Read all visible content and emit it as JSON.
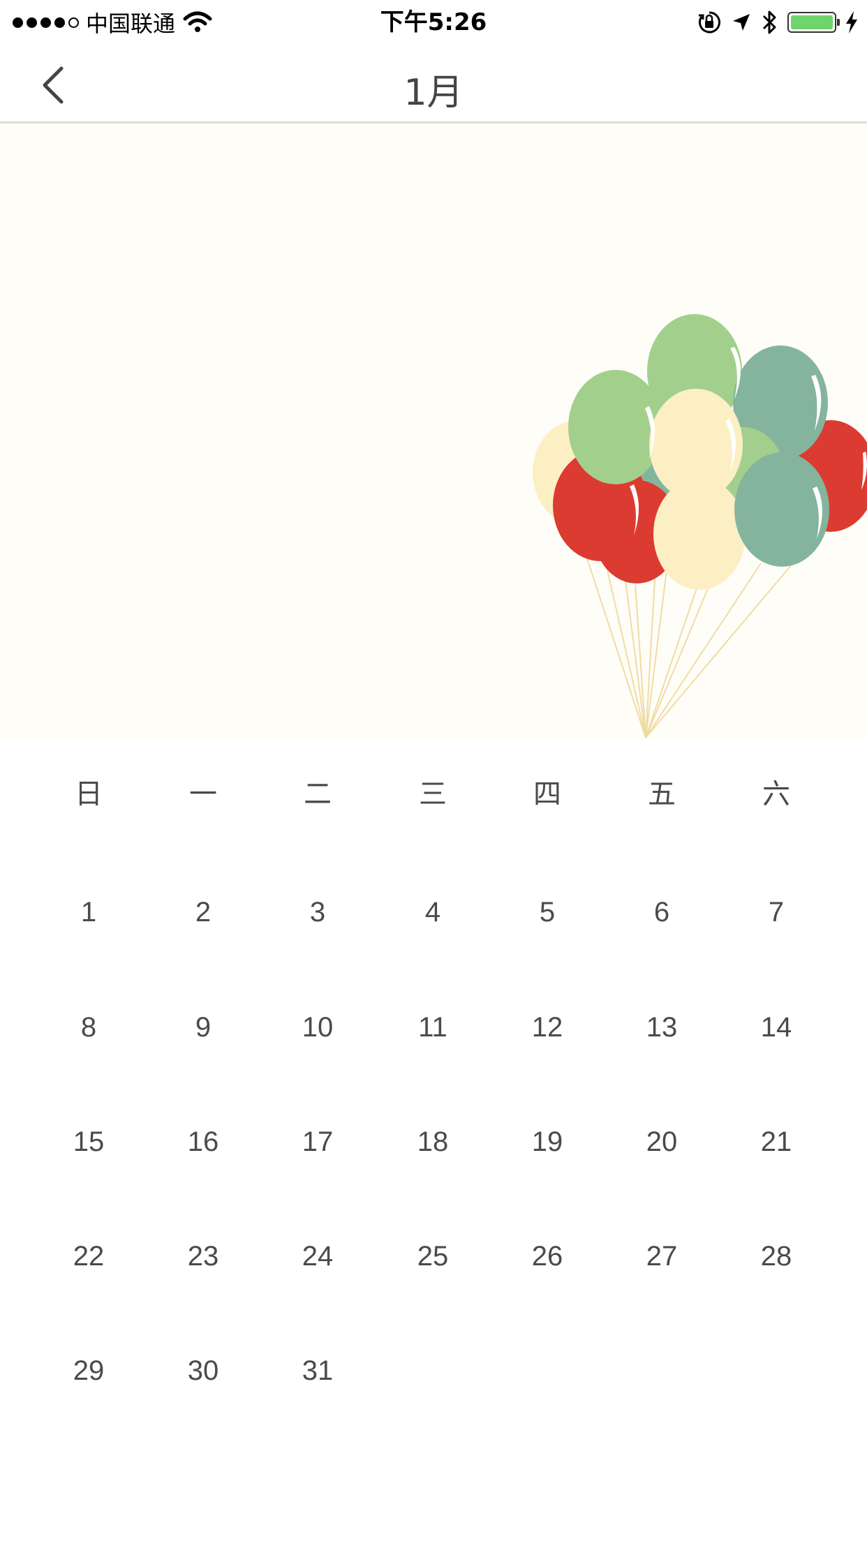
{
  "status_bar": {
    "carrier": "中国联通",
    "time": "下午5:26",
    "battery_color": "#6fd46c"
  },
  "nav": {
    "title": "1月",
    "back_icon": "chevron-left-icon"
  },
  "banner": {
    "illustration": "balloons",
    "background": "#fffdf7"
  },
  "calendar": {
    "weekdays": [
      "日",
      "一",
      "二",
      "三",
      "四",
      "五",
      "六"
    ],
    "weeks": [
      [
        "1",
        "2",
        "3",
        "4",
        "5",
        "6",
        "7"
      ],
      [
        "8",
        "9",
        "10",
        "11",
        "12",
        "13",
        "14"
      ],
      [
        "15",
        "16",
        "17",
        "18",
        "19",
        "20",
        "21"
      ],
      [
        "22",
        "23",
        "24",
        "25",
        "26",
        "27",
        "28"
      ],
      [
        "29",
        "30",
        "31",
        "",
        "",
        "",
        ""
      ]
    ]
  }
}
